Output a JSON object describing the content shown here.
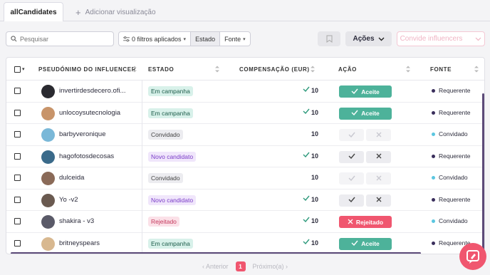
{
  "tabs": {
    "active": "allCandidates",
    "add_label": "Adicionar visualização"
  },
  "toolbar": {
    "search_placeholder": "Pesquisar",
    "filters_applied": "0 filtros aplicados",
    "filter_estado": "Estado",
    "filter_fonte": "Fonte",
    "acoes": "Ações",
    "convide": "Convide influencers"
  },
  "table": {
    "headers": {
      "name": "PSEUDÓNIMO DO INFLUENCER",
      "estado": "ESTADO",
      "comp": "COMPENSAÇÃO (EUR)",
      "acao": "AÇÃO",
      "fonte": "FONTE"
    },
    "rows": [
      {
        "name": "invertirdesdecero.ofi...",
        "estado": "Em campanha",
        "estado_style": "green",
        "check": true,
        "comp": "10",
        "acao": "Aceite",
        "acao_type": "accepted",
        "fonte": "Requerente",
        "fonte_color": "#3a2e5c",
        "avatar_color": "#2a2a30"
      },
      {
        "name": "unlocoysutecnologia",
        "estado": "Em campanha",
        "estado_style": "green",
        "check": true,
        "comp": "10",
        "acao": "Aceite",
        "acao_type": "accepted",
        "fonte": "Requerente",
        "fonte_color": "#3a2e5c",
        "avatar_color": "#c8946a"
      },
      {
        "name": "barbyveronique",
        "estado": "Convidado",
        "estado_style": "grey",
        "check": false,
        "comp": "10",
        "acao": "",
        "acao_type": "pair-disabled",
        "fonte": "Convidado",
        "fonte_color": "#5bc6e0",
        "avatar_color": "#7ab8d8"
      },
      {
        "name": "hagofotosdecosas",
        "estado": "Novo candidato",
        "estado_style": "purple",
        "check": true,
        "comp": "10",
        "acao": "",
        "acao_type": "pair",
        "fonte": "Requerente",
        "fonte_color": "#3a2e5c",
        "avatar_color": "#3a6a8a"
      },
      {
        "name": "dulceida",
        "estado": "Convidado",
        "estado_style": "grey",
        "check": false,
        "comp": "10",
        "acao": "",
        "acao_type": "pair-disabled",
        "fonte": "Convidado",
        "fonte_color": "#5bc6e0",
        "avatar_color": "#8a6a58"
      },
      {
        "name": "Yo -v2",
        "estado": "Novo candidato",
        "estado_style": "purple",
        "check": true,
        "comp": "10",
        "acao": "",
        "acao_type": "pair",
        "fonte": "Requerente",
        "fonte_color": "#3a2e5c",
        "avatar_color": "#6a5a50"
      },
      {
        "name": "shakira - v3",
        "estado": "Rejeitado",
        "estado_style": "pink",
        "check": true,
        "comp": "10",
        "acao": "Rejeitado",
        "acao_type": "rejected",
        "fonte": "Convidado",
        "fonte_color": "#5bc6e0",
        "avatar_color": "#5a5a68"
      },
      {
        "name": "britneyspears",
        "estado": "Em campanha",
        "estado_style": "green",
        "check": true,
        "comp": "10",
        "acao": "Aceite",
        "acao_type": "accepted",
        "fonte": "Requerente",
        "fonte_color": "#3a2e5c",
        "avatar_color": "#d8b890"
      }
    ]
  },
  "pager": {
    "prev": "Anterior",
    "page": "1",
    "next": "Próximo(a)"
  }
}
